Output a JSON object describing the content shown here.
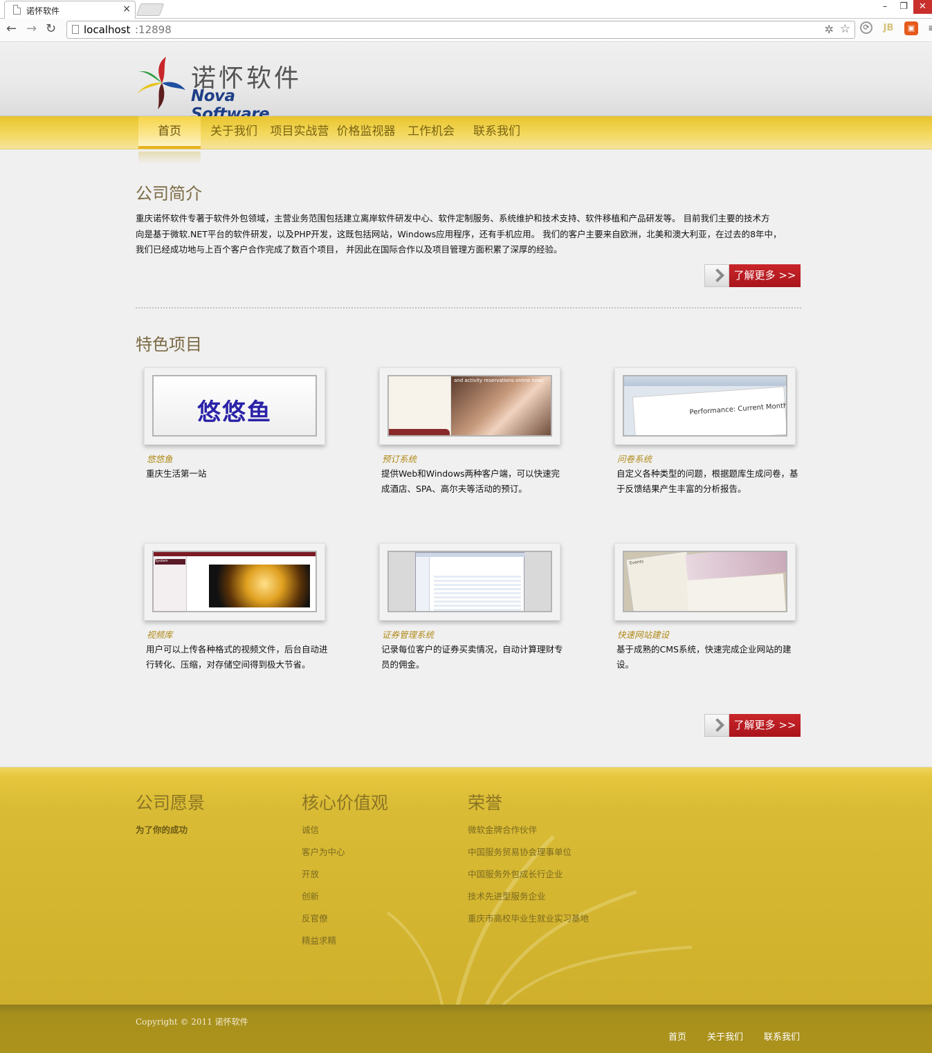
{
  "browser": {
    "tab_title": "诺怀软件",
    "url_host": "localhost",
    "url_port": ":12898"
  },
  "header": {
    "logo_cn": "诺怀软件",
    "logo_en": "Nova Software"
  },
  "nav": {
    "items": [
      {
        "label": "首页",
        "active": true
      },
      {
        "label": "关于我们",
        "active": false
      },
      {
        "label": "项目实战营",
        "active": false
      },
      {
        "label": "价格监视器",
        "active": false
      },
      {
        "label": "工作机会",
        "active": false
      },
      {
        "label": "联系我们",
        "active": false
      }
    ]
  },
  "intro": {
    "title": "公司简介",
    "line1": "重庆诺怀软件专著于软件外包领域，主营业务范围包括建立离岸软件研发中心、软件定制服务、系统维护和技术支持、软件移植和产品研发等。 目前我们主要的技术方",
    "line2": "向是基于微软.NET平台的软件研发，以及PHP开发，这既包括网站，Windows应用程序，还有手机应用。 我们的客户主要来自欧洲，北美和澳大利亚，在过去的8年中，",
    "line3": "我们已经成功地与上百个客户合作完成了数百个项目， 并因此在国际合作以及项目管理方面积累了深厚的经验。",
    "more_label": "了解更多 >>"
  },
  "featured": {
    "title": "特色项目",
    "more_label": "了解更多 >>",
    "projects": [
      {
        "name": "悠悠鱼",
        "desc": "重庆生活第一站",
        "thumb_text": "悠悠鱼"
      },
      {
        "name": "预订系统",
        "desc": "提供Web和Windows两种客户端，可以快速完成酒店、SPA、高尔夫等活动的预订。",
        "thumb_text": "and activity reservations online now!"
      },
      {
        "name": "问卷系统",
        "desc": "自定义各种类型的问题，根据题库生成问卷，基于反馈结果产生丰富的分析报告。",
        "thumb_text": "Performance: Current Month"
      },
      {
        "name": "视频库",
        "desc": "用户可以上传各种格式的视频文件，后台自动进行转化、压缩，对存储空间得到极大节省。",
        "thumb_text": "System"
      },
      {
        "name": "证券管理系统",
        "desc": "记录每位客户的证券买卖情况，自动计算理财专员的佣金。",
        "thumb_text": ""
      },
      {
        "name": "快速网站建设",
        "desc": "基于成熟的CMS系统，快速完成企业网站的建设。",
        "thumb_text": "Events"
      }
    ]
  },
  "footer": {
    "vision": {
      "title": "公司愿景",
      "items": [
        "为了你的成功"
      ]
    },
    "values": {
      "title": "核心价值观",
      "items": [
        "诚信",
        "客户为中心",
        "开放",
        "创新",
        "反官僚",
        "精益求精"
      ]
    },
    "honors": {
      "title": "荣誉",
      "items": [
        "微软金牌合作伙伴",
        "中国服务贸易协会理事单位",
        "中国服务外包成长行企业",
        "技术先进型服务企业",
        "重庆市高校毕业生就业实习基地"
      ]
    },
    "copyright": "Copyright © 2011 诺怀软件",
    "links": [
      "首页",
      "关于我们",
      "联系我们"
    ]
  }
}
